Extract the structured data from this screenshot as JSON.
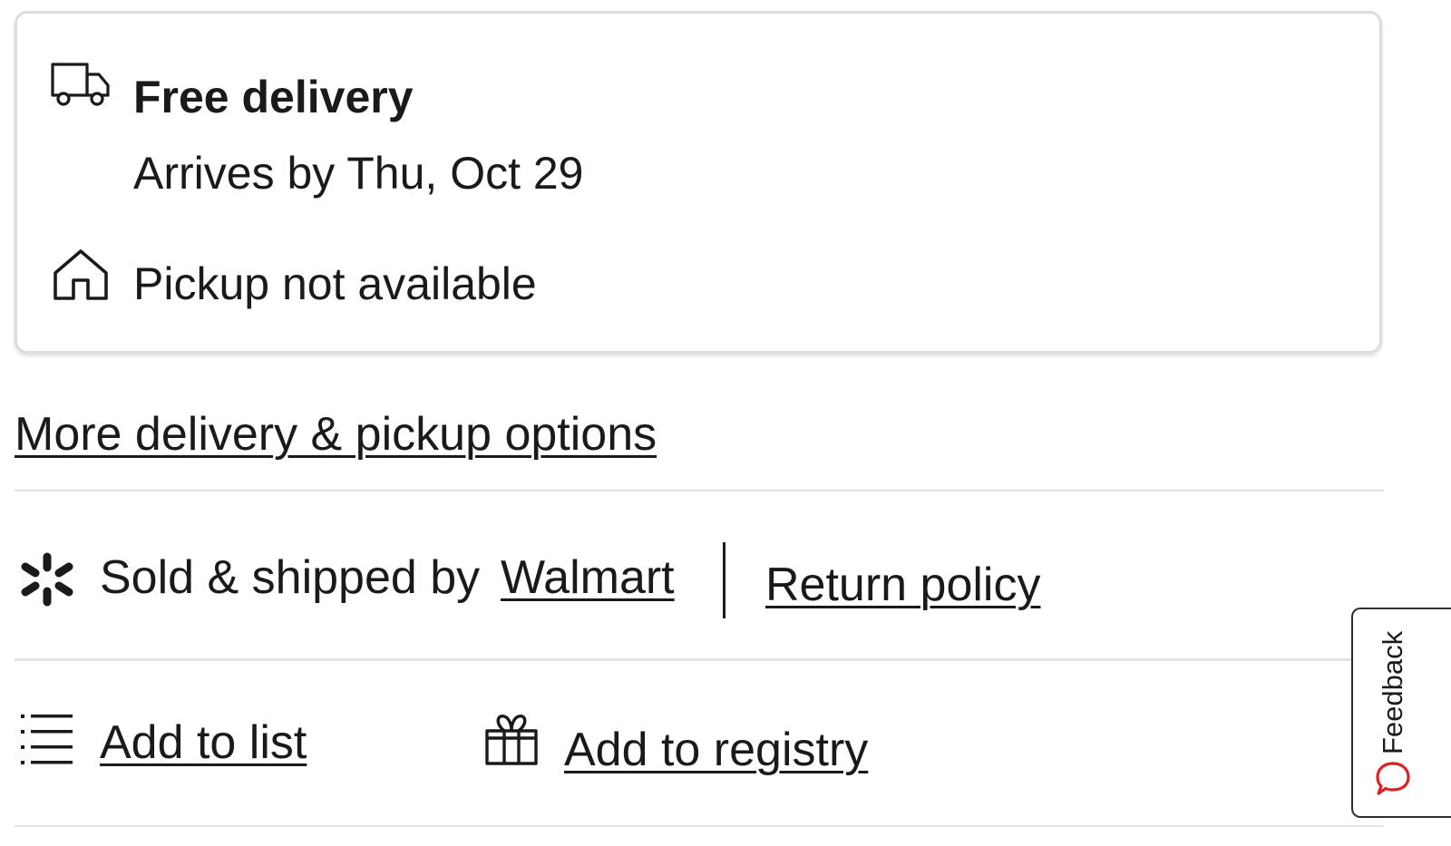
{
  "delivery_card": {
    "delivery_title": "Free delivery",
    "arrival_text": "Arrives by Thu, Oct 29",
    "pickup_text": "Pickup not available",
    "truck_icon": "truck-icon",
    "home_icon": "home-icon"
  },
  "more_options_link": "More delivery & pickup options",
  "seller": {
    "prefix": "Sold & shipped by",
    "name": "Walmart",
    "return_policy": "Return policy",
    "icon": "walmart-spark-icon"
  },
  "actions": {
    "add_to_list": "Add to list",
    "add_to_registry": "Add to registry",
    "list_icon": "list-icon",
    "gift_icon": "gift-icon"
  },
  "feedback": {
    "label": "Feedback",
    "icon": "chat-bubble-icon",
    "icon_color": "#e02020"
  }
}
